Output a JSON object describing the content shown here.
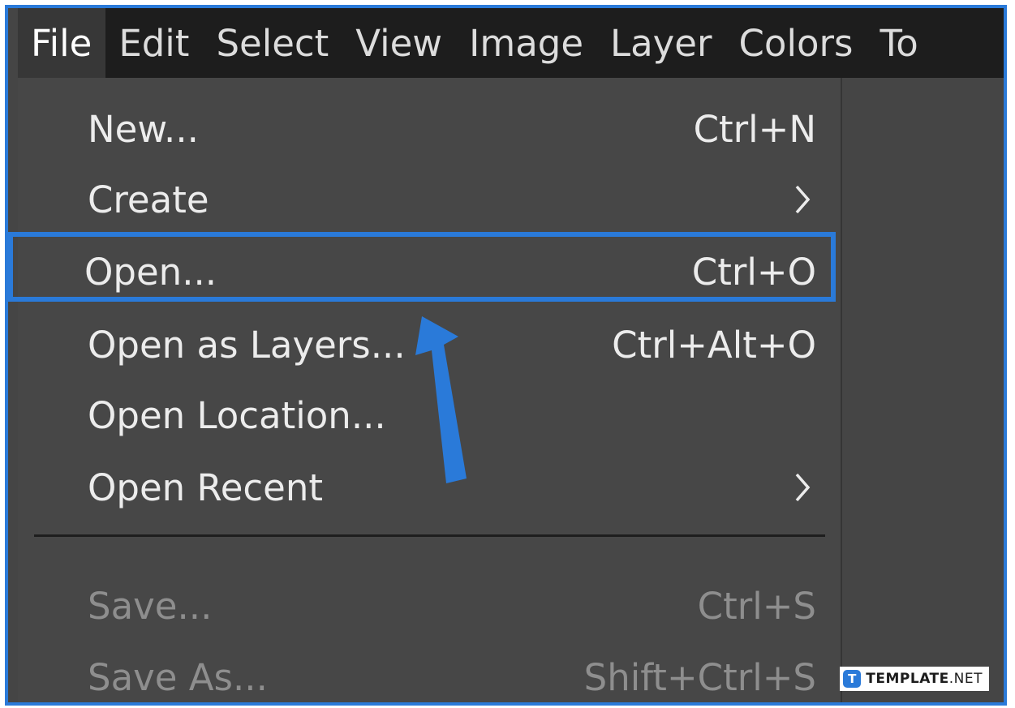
{
  "menubar": {
    "items": [
      {
        "label": "File",
        "active": true
      },
      {
        "label": "Edit"
      },
      {
        "label": "Select"
      },
      {
        "label": "View"
      },
      {
        "label": "Image"
      },
      {
        "label": "Layer"
      },
      {
        "label": "Colors"
      },
      {
        "label": "To"
      }
    ]
  },
  "file_menu": {
    "items": [
      {
        "label": "New...",
        "shortcut": "Ctrl+N"
      },
      {
        "label": "Create",
        "submenu": true
      },
      {
        "label": "Open...",
        "shortcut": "Ctrl+O",
        "highlighted": true
      },
      {
        "label": "Open as Layers...",
        "shortcut": "Ctrl+Alt+O"
      },
      {
        "label": "Open Location..."
      },
      {
        "label": "Open Recent",
        "submenu": true
      },
      {
        "label": "Save...",
        "shortcut": "Ctrl+S",
        "disabled": true
      },
      {
        "label": "Save As...",
        "shortcut": "Shift+Ctrl+S",
        "disabled": true
      }
    ]
  },
  "watermark": {
    "logo_letter": "T",
    "brand": "TEMPLATE",
    "suffix": ".NET"
  },
  "colors": {
    "accent": "#2a7ad9",
    "menubar_bg": "#1d1d1d",
    "menu_bg": "#474747",
    "text": "#ececec",
    "text_disabled": "#8e8e8e"
  }
}
